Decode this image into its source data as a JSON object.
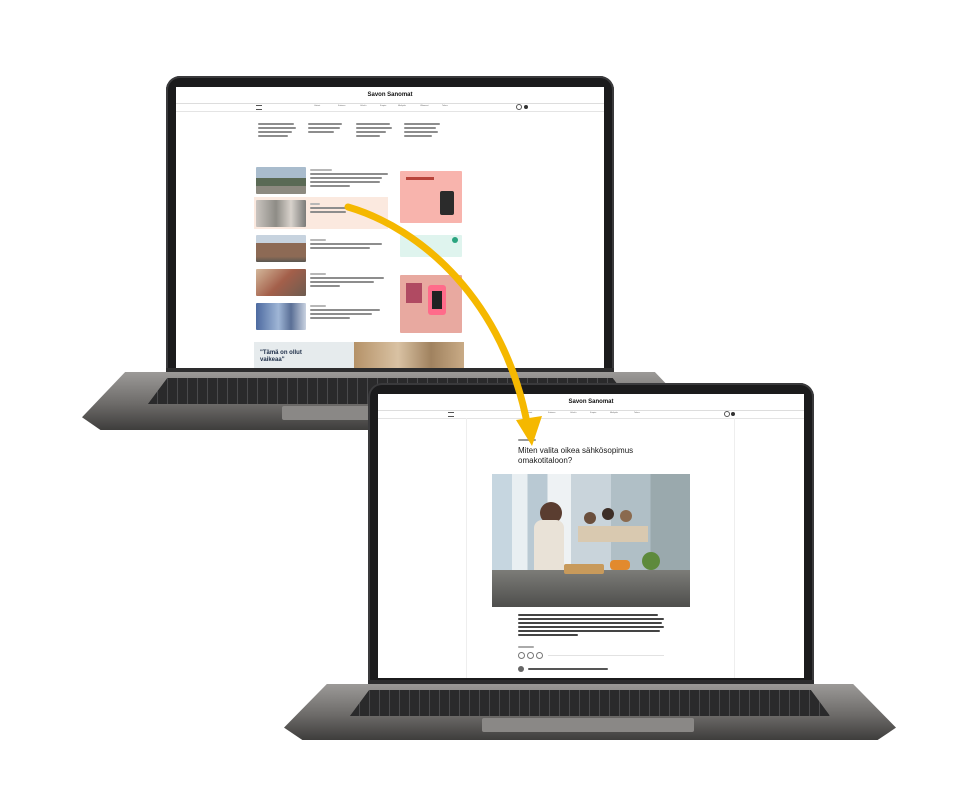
{
  "site": {
    "logo_text": "Savon Sanomat"
  },
  "front_page": {
    "nav_items": [
      "Uutiset",
      "Kotimaa",
      "Urheilu",
      "Kuopio",
      "Mielipide",
      "Ulkomaat",
      "Talous"
    ],
    "quote_teaser": "\"Tämä on ollut vaikeaa\""
  },
  "article_page": {
    "nav_items": [
      "Uutiset",
      "Kotimaa",
      "Urheilu",
      "Kuopio",
      "Mielipide",
      "Talous"
    ],
    "headline": "Miten valita oikea sähkösopimus omakotitaloon?"
  },
  "colors": {
    "arrow": "#f5b800",
    "laptop_bezel": "#1b1b1c",
    "ad_pink": "#f8b4ad",
    "ad_pink_2": "#e8a9a0",
    "ad_mint": "#dff4ee"
  }
}
